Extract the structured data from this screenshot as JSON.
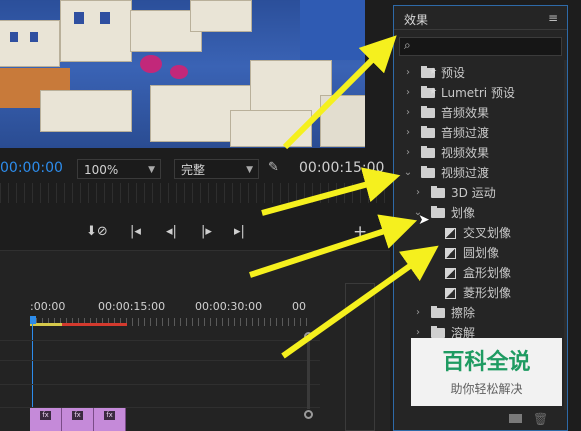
{
  "monitor": {
    "current_timecode": "00:00:00",
    "zoom_value": "100%",
    "quality_value": "完整",
    "duration_timecode": "00:00:15:00"
  },
  "timeline": {
    "ruler_labels": [
      ":00:00",
      "00:00:15:00",
      "00:00:30:00",
      "00"
    ]
  },
  "effects_panel": {
    "title": "效果",
    "menu_icon": "hamburger-icon",
    "search_placeholder": "",
    "items": [
      {
        "label": "预设",
        "icon": "preset-folder-icon",
        "expanded": false
      },
      {
        "label": "Lumetri 预设",
        "icon": "preset-folder-icon",
        "expanded": false
      },
      {
        "label": "音频效果",
        "icon": "folder-icon",
        "expanded": false
      },
      {
        "label": "音频过渡",
        "icon": "folder-icon",
        "expanded": false
      },
      {
        "label": "视频效果",
        "icon": "folder-icon",
        "expanded": false
      },
      {
        "label": "视频过渡",
        "icon": "folder-icon",
        "expanded": true
      },
      {
        "label": "3D 运动",
        "icon": "folder-icon",
        "expanded": false
      },
      {
        "label": "划像",
        "icon": "folder-icon",
        "expanded": true
      },
      {
        "label": "交叉划像",
        "icon": "effect-icon"
      },
      {
        "label": "圆划像",
        "icon": "effect-icon"
      },
      {
        "label": "盒形划像",
        "icon": "effect-icon"
      },
      {
        "label": "菱形划像",
        "icon": "effect-icon"
      },
      {
        "label": "擦除",
        "icon": "folder-icon",
        "expanded": false
      },
      {
        "label": "溶解",
        "icon": "folder-icon",
        "expanded": false
      }
    ]
  },
  "watermark": {
    "title": "百科全说",
    "subtitle": "助你轻松解决"
  },
  "colors": {
    "timecode_blue": "#2d8ceb",
    "arrow_yellow": "#f5f01e",
    "panel_border": "#2e6aa8",
    "clip_pink": "#c58ad9",
    "watermark_green": "#1f9b62"
  }
}
